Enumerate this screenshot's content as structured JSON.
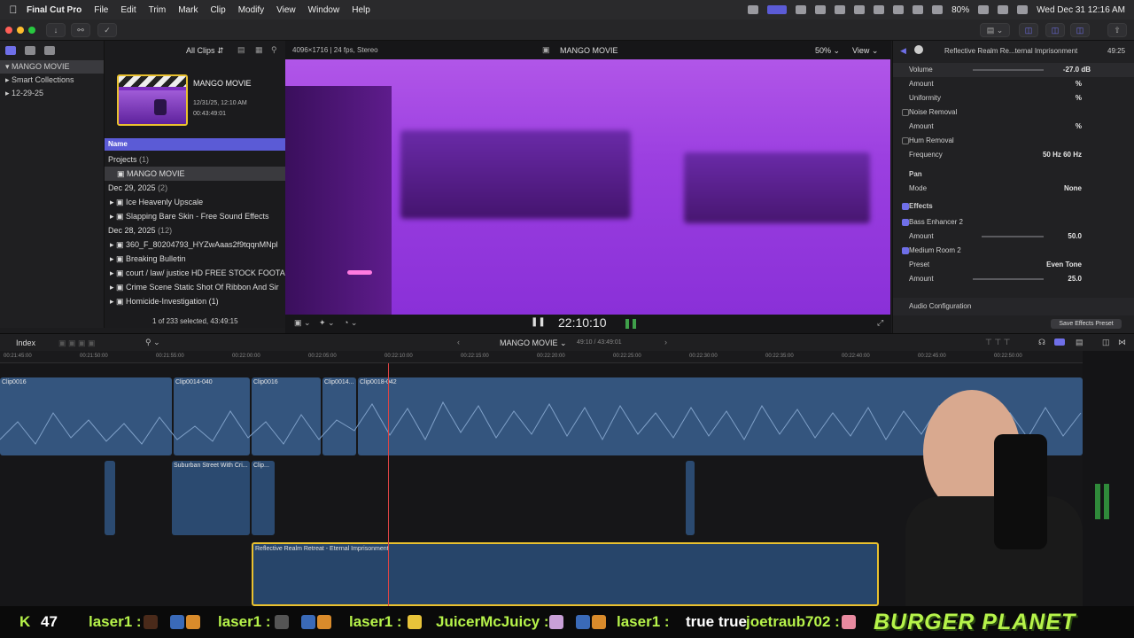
{
  "menubar": {
    "app_name": "Final Cut Pro",
    "items": [
      "File",
      "Edit",
      "Trim",
      "Mark",
      "Clip",
      "Modify",
      "View",
      "Window",
      "Help"
    ],
    "battery": "80%",
    "clock": "Wed Dec 31  12:16 AM"
  },
  "library": {
    "items": [
      {
        "label": "MANGO MOVIE",
        "selected": true
      },
      {
        "label": "Smart Collections",
        "selected": false
      },
      {
        "label": "12-29-25",
        "selected": false
      }
    ]
  },
  "browser": {
    "filter": "All Clips",
    "project_card": {
      "title": "MANGO MOVIE",
      "date": "12/31/25, 12:10 AM",
      "duration": "00:43:49:01"
    },
    "column_header": "Name",
    "groups": [
      {
        "label": "Projects",
        "count": "(1)"
      },
      {
        "label": "Dec 29, 2025",
        "count": "(2)"
      },
      {
        "label": "Dec 28, 2025",
        "count": "(12)"
      }
    ],
    "project_item": "MANGO MOVIE",
    "dec29_items": [
      "Ice Heavenly Upscale",
      "Slapping Bare Skin - Free Sound Effects"
    ],
    "dec28_items": [
      "360_F_80204793_HYZwAaas2f9tqqnMNpl",
      "Breaking Bulletin",
      "court / law/ justice HD FREE STOCK FOOTA",
      "Crime Scene Static Shot Of Ribbon And Sir",
      "Homicide-Investigation (1)"
    ],
    "selection_status": "1 of 233 selected, 43:49:15"
  },
  "viewer": {
    "format": "4096×1716 | 24 fps, Stereo",
    "title": "MANGO MOVIE",
    "zoom": "50%",
    "view_menu": "View",
    "timecode": "22:10:10"
  },
  "inspector": {
    "clip_name": "Reflective Realm Re...ternal Imprisonment",
    "duration": "49:25",
    "rows": [
      {
        "label": "Volume",
        "value": "-27.0  dB",
        "check": "none"
      },
      {
        "label": "Amount",
        "value": "%",
        "check": "none"
      },
      {
        "label": "Uniformity",
        "value": "%",
        "check": "none"
      },
      {
        "label": "Noise Removal",
        "value": "",
        "check": "off"
      },
      {
        "label": "Amount",
        "value": "%",
        "check": "none"
      },
      {
        "label": "Hum Removal",
        "value": "",
        "check": "off"
      },
      {
        "label": "Frequency",
        "value": "50 Hz     60 Hz",
        "check": "none"
      },
      {
        "label": "Pan",
        "value": "",
        "check": "none"
      },
      {
        "label": "Mode",
        "value": "None",
        "check": "none"
      },
      {
        "label": "Effects",
        "value": "",
        "check": "on"
      },
      {
        "label": "Bass Enhancer 2",
        "value": "",
        "check": "on"
      },
      {
        "label": "Amount",
        "value": "50.0",
        "check": "none"
      },
      {
        "label": "Medium Room 2",
        "value": "",
        "check": "on"
      },
      {
        "label": "Preset",
        "value": "Even Tone",
        "check": "none"
      },
      {
        "label": "Amount",
        "value": "25.0",
        "check": "none"
      }
    ],
    "audio_config": "Audio Configuration",
    "save_preset": "Save Effects Preset",
    "accent_color": "#6f6fe8"
  },
  "timeline": {
    "index_label": "Index",
    "project_menu": "MANGO MOVIE",
    "position": "49:10 / 43:49:01",
    "ruler_ticks": [
      "00:21:45:00",
      "00:21:50:00",
      "00:21:55:00",
      "00:22:00:00",
      "00:22:05:00",
      "00:22:10:00",
      "00:22:15:00",
      "00:22:20:00",
      "00:22:25:00",
      "00:22:30:00",
      "00:22:35:00",
      "00:22:40:00",
      "00:22:45:00",
      "00:22:50:00"
    ],
    "primary_clips": [
      "Clip0016",
      "Clip0014-040",
      "Clip0016",
      "Clip0014...",
      "Clip0018-042"
    ],
    "connected_clips": [
      "Suburban Street With Cri...",
      "Clip..."
    ],
    "music_clip": "Reflective Realm Retreat - Eternal Imprisonment"
  },
  "chat": {
    "count": "47",
    "messages": [
      {
        "user": "laser1 :",
        "text": ""
      },
      {
        "user": "laser1 :",
        "text": ""
      },
      {
        "user": "laser1 :",
        "text": ""
      },
      {
        "user": "JuicerMcJuicy :",
        "text": ""
      },
      {
        "user": "laser1 :",
        "text": "true true"
      },
      {
        "user": "joetraub702 :",
        "text": ""
      }
    ],
    "brand": "BURGER PLANET"
  }
}
